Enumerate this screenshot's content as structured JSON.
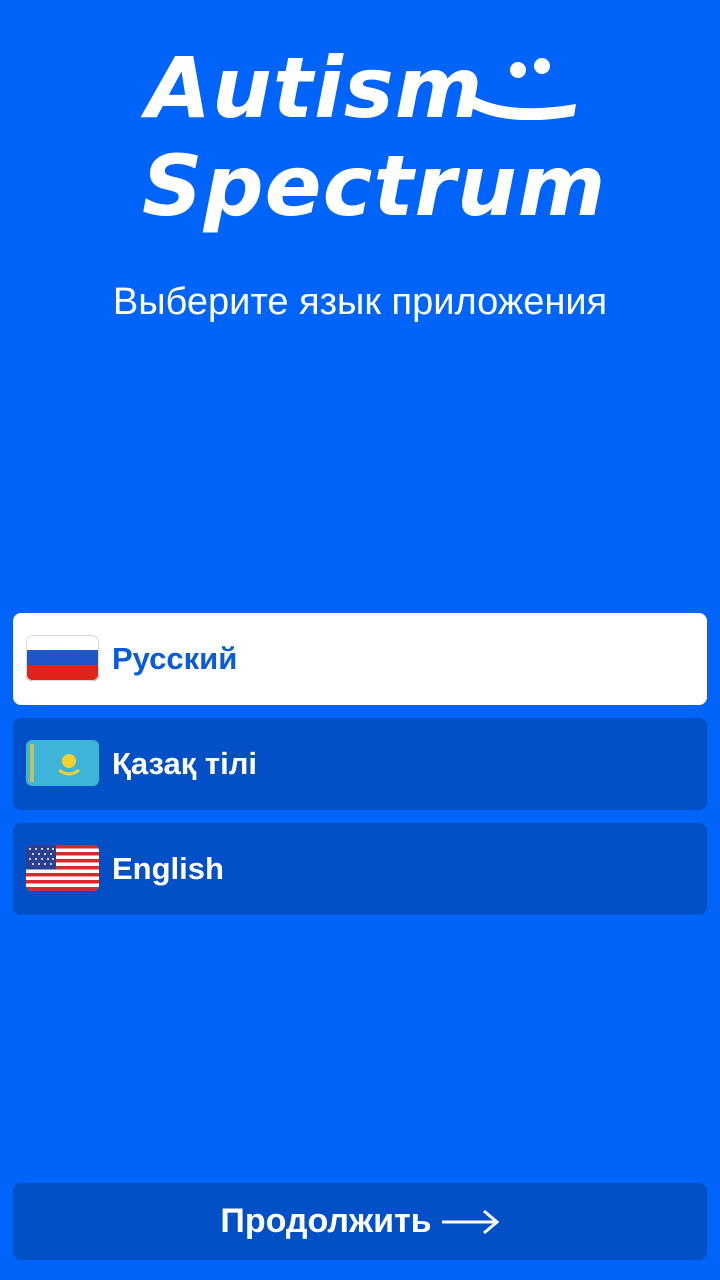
{
  "logo": {
    "line1": "Autism",
    "line2": "Spectrum",
    "mark": "smiley-face-icon"
  },
  "subtitle": "Выберите язык приложения",
  "languages": [
    {
      "label": "Русский",
      "flag": "russia-flag-icon",
      "selected": true
    },
    {
      "label": "Қазақ тілі",
      "flag": "kazakhstan-flag-icon",
      "selected": false
    },
    {
      "label": "English",
      "flag": "usa-flag-icon",
      "selected": false
    }
  ],
  "continue_button": {
    "label": "Продолжить",
    "icon": "arrow-right-icon"
  },
  "colors": {
    "background": "#0064fa",
    "item_bg": "#034fc6",
    "selected_bg": "#ffffff",
    "selected_text": "#0a5bd9"
  }
}
